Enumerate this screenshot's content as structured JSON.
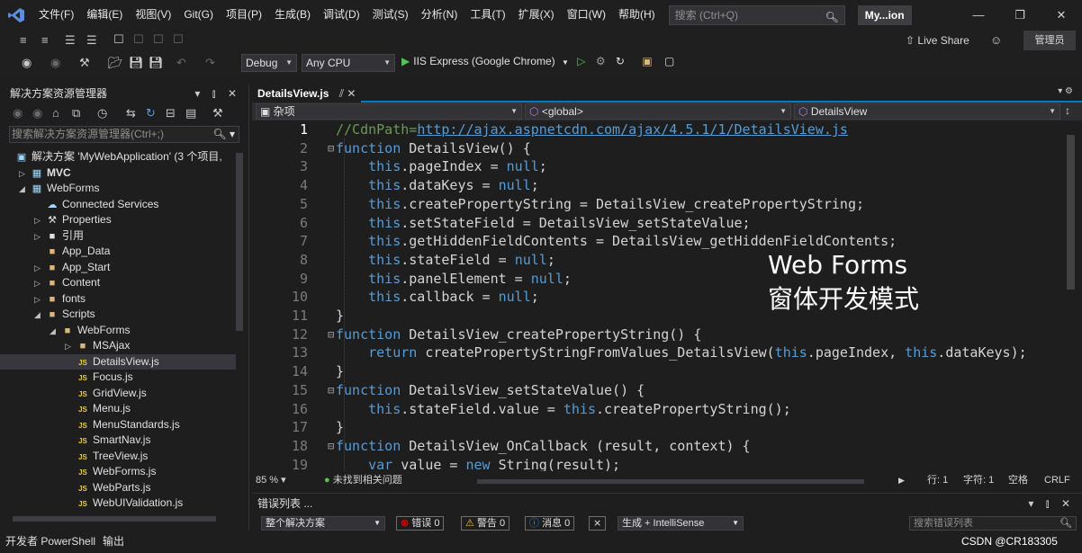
{
  "menu": [
    "文件(F)",
    "编辑(E)",
    "视图(V)",
    "Git(G)",
    "项目(P)",
    "生成(B)",
    "调试(D)",
    "测试(S)",
    "分析(N)",
    "工具(T)",
    "扩展(X)",
    "窗口(W)",
    "帮助(H)"
  ],
  "search": {
    "placeholder": "搜索 (Ctrl+Q)"
  },
  "project_badge": "My...ion",
  "live_share": "Live Share",
  "admin_badge": "管理员",
  "toolbar": {
    "config": "Debug",
    "platform": "Any CPU",
    "run_target": "IIS Express (Google Chrome)"
  },
  "solution_explorer": {
    "title": "解决方案资源管理器",
    "search_placeholder": "搜索解决方案资源管理器(Ctrl+;)",
    "items": [
      {
        "label": "解决方案 'MyWebApplication' (3 个项目,",
        "indent": 0,
        "expander": "",
        "icon": "solution",
        "bold": false,
        "selected": false
      },
      {
        "label": "MVC",
        "indent": 1,
        "expander": "▷",
        "icon": "project",
        "bold": true,
        "selected": false
      },
      {
        "label": "WebForms",
        "indent": 1,
        "expander": "◢",
        "icon": "project",
        "bold": false,
        "selected": false
      },
      {
        "label": "Connected Services",
        "indent": 2,
        "expander": "",
        "icon": "service",
        "bold": false,
        "selected": false
      },
      {
        "label": "Properties",
        "indent": 2,
        "expander": "▷",
        "icon": "wrench",
        "bold": false,
        "selected": false
      },
      {
        "label": "引用",
        "indent": 2,
        "expander": "▷",
        "icon": "reference",
        "bold": false,
        "selected": false
      },
      {
        "label": "App_Data",
        "indent": 2,
        "expander": "",
        "icon": "folder",
        "bold": false,
        "selected": false
      },
      {
        "label": "App_Start",
        "indent": 2,
        "expander": "▷",
        "icon": "folder",
        "bold": false,
        "selected": false
      },
      {
        "label": "Content",
        "indent": 2,
        "expander": "▷",
        "icon": "folder",
        "bold": false,
        "selected": false
      },
      {
        "label": "fonts",
        "indent": 2,
        "expander": "▷",
        "icon": "folder",
        "bold": false,
        "selected": false
      },
      {
        "label": "Scripts",
        "indent": 2,
        "expander": "◢",
        "icon": "folder",
        "bold": false,
        "selected": false
      },
      {
        "label": "WebForms",
        "indent": 3,
        "expander": "◢",
        "icon": "folder",
        "bold": false,
        "selected": false
      },
      {
        "label": "MSAjax",
        "indent": 4,
        "expander": "▷",
        "icon": "folder",
        "bold": false,
        "selected": false
      },
      {
        "label": "DetailsView.js",
        "indent": 4,
        "expander": "",
        "icon": "js",
        "bold": false,
        "selected": true
      },
      {
        "label": "Focus.js",
        "indent": 4,
        "expander": "",
        "icon": "js",
        "bold": false,
        "selected": false
      },
      {
        "label": "GridView.js",
        "indent": 4,
        "expander": "",
        "icon": "js",
        "bold": false,
        "selected": false
      },
      {
        "label": "Menu.js",
        "indent": 4,
        "expander": "",
        "icon": "js",
        "bold": false,
        "selected": false
      },
      {
        "label": "MenuStandards.js",
        "indent": 4,
        "expander": "",
        "icon": "js",
        "bold": false,
        "selected": false
      },
      {
        "label": "SmartNav.js",
        "indent": 4,
        "expander": "",
        "icon": "js",
        "bold": false,
        "selected": false
      },
      {
        "label": "TreeView.js",
        "indent": 4,
        "expander": "",
        "icon": "js",
        "bold": false,
        "selected": false
      },
      {
        "label": "WebForms.js",
        "indent": 4,
        "expander": "",
        "icon": "js",
        "bold": false,
        "selected": false
      },
      {
        "label": "WebParts.js",
        "indent": 4,
        "expander": "",
        "icon": "js",
        "bold": false,
        "selected": false
      },
      {
        "label": "WebUIValidation.js",
        "indent": 4,
        "expander": "",
        "icon": "js",
        "bold": false,
        "selected": false
      }
    ]
  },
  "editor": {
    "tab": "DetailsView.js",
    "nav": [
      "杂项",
      "<global>",
      "DetailsView"
    ],
    "current_line": 1,
    "lines": [
      {
        "n": 1,
        "fold": "",
        "tokens": [
          [
            "cm",
            "//CdnPath="
          ],
          [
            "lnk",
            "http://ajax.aspnetcdn.com/ajax/4.5.1/1/DetailsView.js"
          ]
        ]
      },
      {
        "n": 2,
        "fold": "⊟",
        "tokens": [
          [
            "kw",
            "function"
          ],
          [
            "pl",
            " DetailsView() {"
          ]
        ]
      },
      {
        "n": 3,
        "fold": "",
        "tokens": [
          [
            "pl",
            "    "
          ],
          [
            "kw",
            "this"
          ],
          [
            "pl",
            ".pageIndex = "
          ],
          [
            "kw",
            "null"
          ],
          [
            "pl",
            ";"
          ]
        ]
      },
      {
        "n": 4,
        "fold": "",
        "tokens": [
          [
            "pl",
            "    "
          ],
          [
            "kw",
            "this"
          ],
          [
            "pl",
            ".dataKeys = "
          ],
          [
            "kw",
            "null"
          ],
          [
            "pl",
            ";"
          ]
        ]
      },
      {
        "n": 5,
        "fold": "",
        "tokens": [
          [
            "pl",
            "    "
          ],
          [
            "kw",
            "this"
          ],
          [
            "pl",
            ".createPropertyString = DetailsView_createPropertyString;"
          ]
        ]
      },
      {
        "n": 6,
        "fold": "",
        "tokens": [
          [
            "pl",
            "    "
          ],
          [
            "kw",
            "this"
          ],
          [
            "pl",
            ".setStateField = DetailsView_setStateValue;"
          ]
        ]
      },
      {
        "n": 7,
        "fold": "",
        "tokens": [
          [
            "pl",
            "    "
          ],
          [
            "kw",
            "this"
          ],
          [
            "pl",
            ".getHiddenFieldContents = DetailsView_getHiddenFieldContents;"
          ]
        ]
      },
      {
        "n": 8,
        "fold": "",
        "tokens": [
          [
            "pl",
            "    "
          ],
          [
            "kw",
            "this"
          ],
          [
            "pl",
            ".stateField = "
          ],
          [
            "kw",
            "null"
          ],
          [
            "pl",
            ";"
          ]
        ]
      },
      {
        "n": 9,
        "fold": "",
        "tokens": [
          [
            "pl",
            "    "
          ],
          [
            "kw",
            "this"
          ],
          [
            "pl",
            ".panelElement = "
          ],
          [
            "kw",
            "null"
          ],
          [
            "pl",
            ";"
          ]
        ]
      },
      {
        "n": 10,
        "fold": "",
        "tokens": [
          [
            "pl",
            "    "
          ],
          [
            "kw",
            "this"
          ],
          [
            "pl",
            ".callback = "
          ],
          [
            "kw",
            "null"
          ],
          [
            "pl",
            ";"
          ]
        ]
      },
      {
        "n": 11,
        "fold": "",
        "tokens": [
          [
            "pl",
            "}"
          ]
        ]
      },
      {
        "n": 12,
        "fold": "⊟",
        "tokens": [
          [
            "kw",
            "function"
          ],
          [
            "pl",
            " DetailsView_createPropertyString() {"
          ]
        ]
      },
      {
        "n": 13,
        "fold": "",
        "tokens": [
          [
            "pl",
            "    "
          ],
          [
            "kw",
            "return"
          ],
          [
            "pl",
            " createPropertyStringFromValues_DetailsView("
          ],
          [
            "kw",
            "this"
          ],
          [
            "pl",
            ".pageIndex, "
          ],
          [
            "kw",
            "this"
          ],
          [
            "pl",
            ".dataKeys);"
          ]
        ]
      },
      {
        "n": 14,
        "fold": "",
        "tokens": [
          [
            "pl",
            "}"
          ]
        ]
      },
      {
        "n": 15,
        "fold": "⊟",
        "tokens": [
          [
            "kw",
            "function"
          ],
          [
            "pl",
            " DetailsView_setStateValue() {"
          ]
        ]
      },
      {
        "n": 16,
        "fold": "",
        "tokens": [
          [
            "pl",
            "    "
          ],
          [
            "kw",
            "this"
          ],
          [
            "pl",
            ".stateField.value = "
          ],
          [
            "kw",
            "this"
          ],
          [
            "pl",
            ".createPropertyString();"
          ]
        ]
      },
      {
        "n": 17,
        "fold": "",
        "tokens": [
          [
            "pl",
            "}"
          ]
        ]
      },
      {
        "n": 18,
        "fold": "⊟",
        "tokens": [
          [
            "kw",
            "function"
          ],
          [
            "pl",
            " DetailsView_OnCallback (result, context) {"
          ]
        ]
      },
      {
        "n": 19,
        "fold": "",
        "tokens": [
          [
            "pl",
            "    "
          ],
          [
            "kw",
            "var"
          ],
          [
            "pl",
            " value = "
          ],
          [
            "kw",
            "new"
          ],
          [
            "pl",
            " String(result);"
          ]
        ]
      }
    ],
    "overlay": [
      "Web Forms",
      "窗体开发模式"
    ],
    "zoom": "85 %",
    "issues": "未找到相关问题",
    "row": "行: 1",
    "col": "字符: 1",
    "indent_mode": "空格",
    "eol": "CRLF"
  },
  "error_list": {
    "title": "错误列表 ...",
    "scope": "整个解决方案",
    "errors": "错误 0",
    "warnings": "警告 0",
    "messages": "消息 0",
    "build": "生成 + IntelliSense",
    "search_placeholder": "搜索错误列表"
  },
  "statusbar": {
    "left": [
      "开发者 PowerShell",
      "输出"
    ],
    "watermark": "CSDN @CR183305"
  },
  "colors": {
    "accent": "#007acc",
    "keyword": "#569cd6",
    "comment": "#6a9955",
    "function": "#dcdcaa"
  }
}
